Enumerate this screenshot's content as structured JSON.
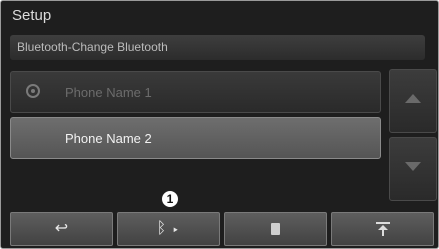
{
  "header": {
    "title": "Setup"
  },
  "subheader": {
    "label": "Bluetooth-Change Bluetooth"
  },
  "device_list": {
    "items": [
      {
        "label": "Phone Name 1",
        "state": "connected-dimmed"
      },
      {
        "label": "Phone Name 2",
        "state": "highlighted"
      }
    ]
  },
  "scroll": {
    "up_icon": "triangle-up-icon",
    "down_icon": "triangle-down-icon"
  },
  "toolbar": {
    "back_glyph": "↩",
    "bluetooth_glyph": "ᛒ ▸",
    "file_icon": "document-icon",
    "top_icon": "move-to-top-icon"
  },
  "callout": {
    "number": "1"
  },
  "colors": {
    "background": "#1e1e1e",
    "highlight": "#606060",
    "text": "#f2f2f2"
  }
}
